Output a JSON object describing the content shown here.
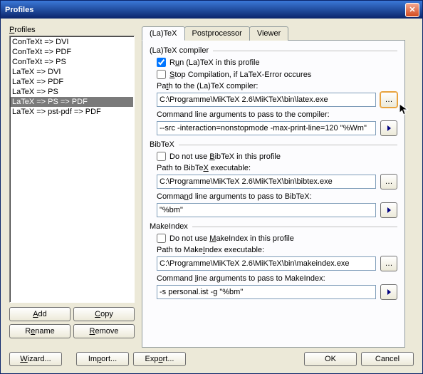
{
  "window": {
    "title": "Profiles"
  },
  "left": {
    "label": "Profiles",
    "items": [
      "ConTeXt => DVI",
      "ConTeXt => PDF",
      "ConTeXt => PS",
      "LaTeX => DVI",
      "LaTeX => PDF",
      "LaTeX => PS",
      "LaTeX => PS => PDF",
      "LaTeX => pst-pdf => PDF"
    ],
    "selected_index": 6,
    "buttons": {
      "add": "Add",
      "copy": "Copy",
      "rename": "Rename",
      "remove": "Remove"
    }
  },
  "tabs": {
    "latex": "(La)TeX",
    "postproc": "Postprocessor",
    "viewer": "Viewer",
    "active": 0
  },
  "latex_group": {
    "header": "(La)TeX compiler",
    "run_label": "Run (La)TeX in this profile",
    "run_checked": true,
    "stop_label": "Stop Compilation, if LaTeX-Error occures",
    "stop_checked": false,
    "path_label": "Path to the (La)TeX compiler:",
    "path_value": "C:\\Programme\\MiKTeX 2.6\\MiKTeX\\bin\\latex.exe",
    "args_label": "Command line arguments to pass to the compiler:",
    "args_value": "--src -interaction=nonstopmode -max-print-line=120 \"%Wm\""
  },
  "bibtex_group": {
    "header": "BibTeX",
    "skip_label": "Do not use BibTeX in this profile",
    "skip_checked": false,
    "path_label": "Path to BibTeX executable:",
    "path_value": "C:\\Programme\\MiKTeX 2.6\\MiKTeX\\bin\\bibtex.exe",
    "args_label": "Command line arguments to pass to BibTeX:",
    "args_value": "\"%bm\""
  },
  "makeindex_group": {
    "header": "MakeIndex",
    "skip_label": "Do not use MakeIndex in this profile",
    "skip_checked": false,
    "path_label": "Path to MakeIndex executable:",
    "path_value": "C:\\Programme\\MiKTeX 2.6\\MiKTeX\\bin\\makeindex.exe",
    "args_label": "Command line arguments to pass to MakeIndex:",
    "args_value": "-s personal.ist -g \"%bm\""
  },
  "bottom": {
    "wizard": "Wizard...",
    "import": "Import...",
    "export": "Export...",
    "ok": "OK",
    "cancel": "Cancel"
  }
}
